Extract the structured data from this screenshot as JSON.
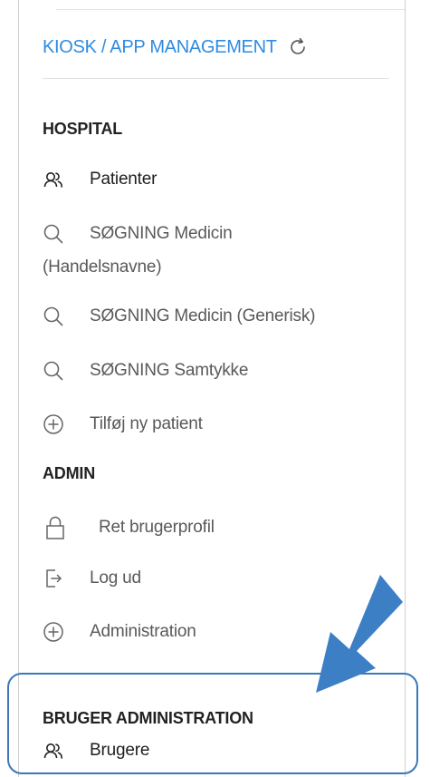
{
  "header": {
    "title": "KIOSK / APP MANAGEMENT",
    "refresh_icon": "refresh-icon",
    "accent_color": "#2f8be0"
  },
  "sections": {
    "hospital": {
      "title": "HOSPITAL",
      "items": [
        {
          "label": "Patienter",
          "icon": "users-icon"
        },
        {
          "label_line1": "SØGNING Medicin",
          "label_line2": "(Handelsnavne)",
          "icon": "search-icon"
        },
        {
          "label": "SØGNING Medicin (Generisk)",
          "icon": "search-icon"
        },
        {
          "label": "SØGNING Samtykke",
          "icon": "search-icon"
        },
        {
          "label": "Tilføj ny patient",
          "icon": "plus-circle-icon"
        }
      ]
    },
    "admin": {
      "title": "ADMIN",
      "items": [
        {
          "label": "Ret brugerprofil",
          "icon": "lock-icon"
        },
        {
          "label": "Log ud",
          "icon": "logout-icon"
        },
        {
          "label": "Administration",
          "icon": "plus-circle-icon"
        }
      ]
    },
    "user_admin": {
      "title": "BRUGER ADMINISTRATION",
      "items": [
        {
          "label": "Brugere",
          "icon": "users-icon"
        }
      ]
    }
  },
  "annotation": {
    "highlight_color": "#3a78b9",
    "arrow_color": "#3d7fc4"
  }
}
